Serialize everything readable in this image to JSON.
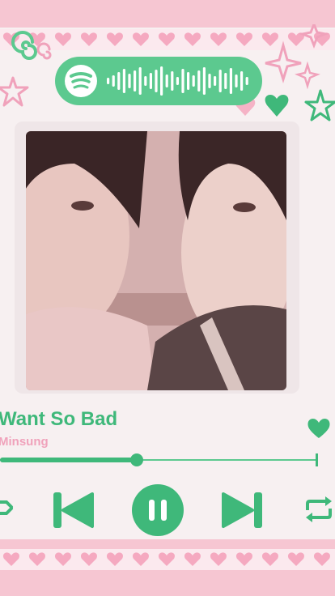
{
  "player": {
    "title": "Want So Bad",
    "artist": "Minsung",
    "progress_fraction": 0.43,
    "liked": true,
    "playing": true
  },
  "colors": {
    "accent": "#3fb87a",
    "accent_light": "#5cc98f",
    "pink": "#f0a2bb",
    "band": "#f6c6d2",
    "background": "#f7f0f1"
  },
  "icons": {
    "brand": "spotify-icon",
    "like": "heart-icon",
    "shuffle": "shuffle-icon",
    "previous": "skip-previous-icon",
    "play_state": "pause-icon",
    "next": "skip-next-icon",
    "repeat": "repeat-icon"
  }
}
